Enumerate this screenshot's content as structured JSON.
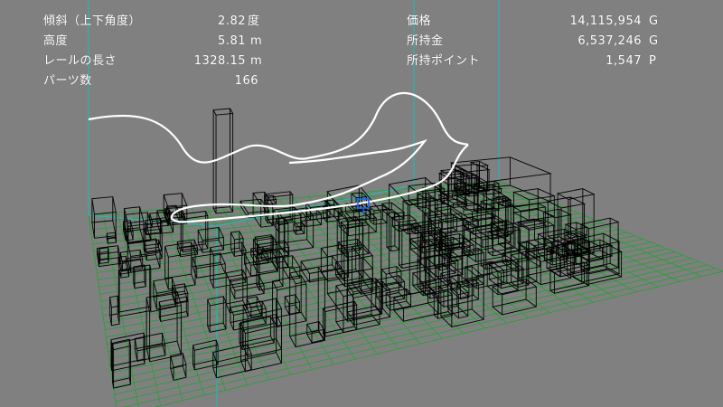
{
  "hud": {
    "left": [
      {
        "label": "傾斜（上下角度）",
        "value": "2.82",
        "unit": "度"
      },
      {
        "label": "高度",
        "value": "5.81",
        "unit": "m"
      },
      {
        "label": "レールの長さ",
        "value": "1328.15",
        "unit": "m"
      },
      {
        "label": "パーツ数",
        "value": "166",
        "unit": ""
      }
    ],
    "right": [
      {
        "label": "価格",
        "value": "14,115,954",
        "unit": "G"
      },
      {
        "label": "所持金",
        "value": "6,537,246",
        "unit": "G"
      },
      {
        "label": "所持ポイント",
        "value": "1,547",
        "unit": "P"
      }
    ]
  },
  "scene": {
    "colors": {
      "background": "#808080",
      "bounds": "#30b0b0",
      "grid": "#2e9e3a",
      "buildings": "#000000",
      "track": "#ffffff",
      "cursor": "#1565ff"
    }
  }
}
